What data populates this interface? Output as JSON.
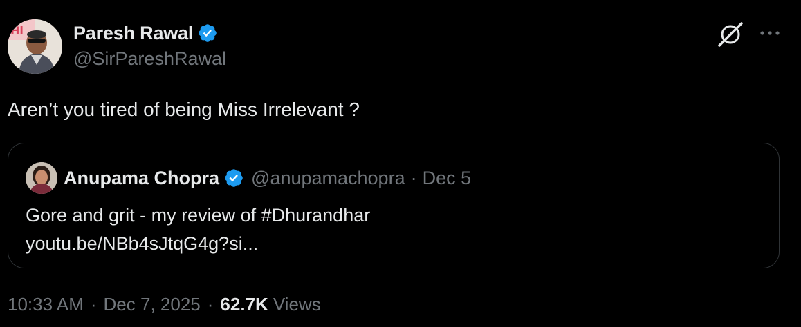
{
  "tweet": {
    "author": {
      "name": "Paresh Rawal",
      "handle": "@SirPareshRawal",
      "verified_icon": "verified-badge-icon"
    },
    "text": "Aren’t you tired of being Miss Irrelevant ?",
    "quoted_tweet": {
      "author_name": "Anupama Chopra",
      "author_handle": "@anupamachopra",
      "separator": "·",
      "date": "Dec 5",
      "body_line1": "Gore and grit - my review of #Dhurandhar",
      "body_line2": "youtu.be/NBb4sJtqG4g?si..."
    },
    "meta": {
      "time": "10:33 AM",
      "separator": "·",
      "date": "Dec 7, 2025",
      "views_count": "62.7K",
      "views_label": "Views"
    }
  },
  "icons": {
    "grok": "grok-icon",
    "more": "more-options-icon",
    "verified": "verified-badge-icon"
  },
  "colors": {
    "background": "#000000",
    "primary_text": "#e7e9ea",
    "secondary_text": "#71767b",
    "verified_blue": "#1d9bf0",
    "border": "#2f3336"
  }
}
